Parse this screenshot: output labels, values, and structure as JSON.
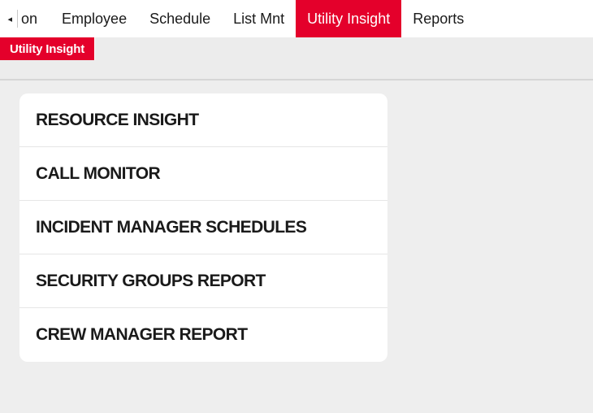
{
  "topnav": {
    "scroll_left_glyph": "◂",
    "tabs": [
      {
        "label": "on",
        "active": false
      },
      {
        "label": "Employee",
        "active": false
      },
      {
        "label": "Schedule",
        "active": false
      },
      {
        "label": "List Mnt",
        "active": false
      },
      {
        "label": "Utility Insight",
        "active": true
      },
      {
        "label": "Reports",
        "active": false
      }
    ]
  },
  "subnav": {
    "active_tab": "Utility Insight"
  },
  "menu": {
    "items": [
      "RESOURCE INSIGHT",
      "CALL MONITOR",
      "INCIDENT MANAGER SCHEDULES",
      "SECURITY GROUPS REPORT",
      "CREW MANAGER REPORT"
    ]
  },
  "colors": {
    "accent": "#e4002b",
    "background": "#eeeeee",
    "card": "#ffffff"
  }
}
